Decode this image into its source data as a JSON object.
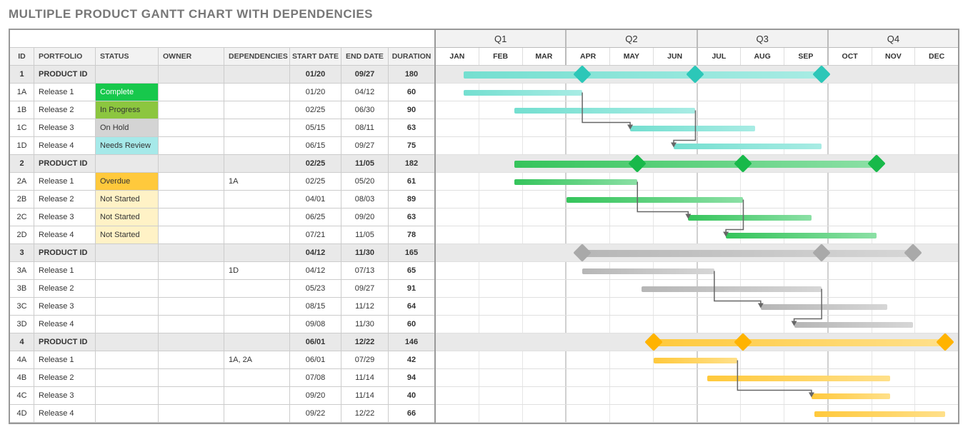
{
  "title": "MULTIPLE PRODUCT GANTT CHART WITH DEPENDENCIES",
  "headers": {
    "id": "ID",
    "portfolio": "PORTFOLIO",
    "status": "STATUS",
    "owner": "OWNER",
    "dependencies": "DEPENDENCIES",
    "start": "START DATE",
    "end": "END DATE",
    "duration": "DURATION"
  },
  "quarters": [
    "Q1",
    "Q2",
    "Q3",
    "Q4"
  ],
  "months": [
    "JAN",
    "FEB",
    "MAR",
    "APR",
    "MAY",
    "JUN",
    "JUL",
    "AUG",
    "SEP",
    "OCT",
    "NOV",
    "DEC"
  ],
  "status_labels": {
    "complete": "Complete",
    "inprogress": "In Progress",
    "onhold": "On Hold",
    "needsreview": "Needs Review",
    "overdue": "Overdue",
    "notstarted": "Not Started"
  },
  "colors": {
    "p1": {
      "barA": "#74dfd0",
      "barB": "#a8ece4",
      "diam": "#2cc7b8"
    },
    "p2": {
      "barA": "#35c45b",
      "barB": "#8be0a5",
      "diam": "#18b94a"
    },
    "p3": {
      "barA": "#b6b6b6",
      "barB": "#d6d6d6",
      "diam": "#a9a9a9"
    },
    "p4": {
      "barA": "#ffc93c",
      "barB": "#ffe08a",
      "diam": "#ffb300"
    }
  },
  "rows": [
    {
      "id": "1",
      "portfolio": "PRODUCT ID",
      "status": "",
      "owner": "",
      "dep": "",
      "start": "01/20",
      "end": "09/27",
      "dur": "180",
      "product": true,
      "group": "p1"
    },
    {
      "id": "1A",
      "portfolio": "Release 1",
      "statusKey": "complete",
      "owner": "",
      "dep": "",
      "start": "01/20",
      "end": "04/12",
      "dur": "60",
      "group": "p1"
    },
    {
      "id": "1B",
      "portfolio": "Release 2",
      "statusKey": "inprogress",
      "owner": "",
      "dep": "",
      "start": "02/25",
      "end": "06/30",
      "dur": "90",
      "group": "p1"
    },
    {
      "id": "1C",
      "portfolio": "Release 3",
      "statusKey": "onhold",
      "owner": "",
      "dep": "",
      "start": "05/15",
      "end": "08/11",
      "dur": "63",
      "group": "p1"
    },
    {
      "id": "1D",
      "portfolio": "Release 4",
      "statusKey": "needsreview",
      "owner": "",
      "dep": "",
      "start": "06/15",
      "end": "09/27",
      "dur": "75",
      "group": "p1"
    },
    {
      "id": "2",
      "portfolio": "PRODUCT ID",
      "status": "",
      "owner": "",
      "dep": "",
      "start": "02/25",
      "end": "11/05",
      "dur": "182",
      "product": true,
      "group": "p2"
    },
    {
      "id": "2A",
      "portfolio": "Release 1",
      "statusKey": "overdue",
      "owner": "",
      "dep": "1A",
      "start": "02/25",
      "end": "05/20",
      "dur": "61",
      "group": "p2"
    },
    {
      "id": "2B",
      "portfolio": "Release 2",
      "statusKey": "notstarted",
      "owner": "",
      "dep": "",
      "start": "04/01",
      "end": "08/03",
      "dur": "89",
      "group": "p2"
    },
    {
      "id": "2C",
      "portfolio": "Release 3",
      "statusKey": "notstarted",
      "owner": "",
      "dep": "",
      "start": "06/25",
      "end": "09/20",
      "dur": "63",
      "group": "p2"
    },
    {
      "id": "2D",
      "portfolio": "Release 4",
      "statusKey": "notstarted",
      "owner": "",
      "dep": "",
      "start": "07/21",
      "end": "11/05",
      "dur": "78",
      "group": "p2"
    },
    {
      "id": "3",
      "portfolio": "PRODUCT ID",
      "status": "",
      "owner": "",
      "dep": "",
      "start": "04/12",
      "end": "11/30",
      "dur": "165",
      "product": true,
      "group": "p3"
    },
    {
      "id": "3A",
      "portfolio": "Release 1",
      "statusKey": "",
      "owner": "",
      "dep": "1D",
      "start": "04/12",
      "end": "07/13",
      "dur": "65",
      "group": "p3"
    },
    {
      "id": "3B",
      "portfolio": "Release 2",
      "statusKey": "",
      "owner": "",
      "dep": "",
      "start": "05/23",
      "end": "09/27",
      "dur": "91",
      "group": "p3"
    },
    {
      "id": "3C",
      "portfolio": "Release 3",
      "statusKey": "",
      "owner": "",
      "dep": "",
      "start": "08/15",
      "end": "11/12",
      "dur": "64",
      "group": "p3"
    },
    {
      "id": "3D",
      "portfolio": "Release 4",
      "statusKey": "",
      "owner": "",
      "dep": "",
      "start": "09/08",
      "end": "11/30",
      "dur": "60",
      "group": "p3"
    },
    {
      "id": "4",
      "portfolio": "PRODUCT ID",
      "status": "",
      "owner": "",
      "dep": "",
      "start": "06/01",
      "end": "12/22",
      "dur": "146",
      "product": true,
      "group": "p4"
    },
    {
      "id": "4A",
      "portfolio": "Release 1",
      "statusKey": "",
      "owner": "",
      "dep": "1A, 2A",
      "start": "06/01",
      "end": "07/29",
      "dur": "42",
      "group": "p4"
    },
    {
      "id": "4B",
      "portfolio": "Release 2",
      "statusKey": "",
      "owner": "",
      "dep": "",
      "start": "07/08",
      "end": "11/14",
      "dur": "94",
      "group": "p4"
    },
    {
      "id": "4C",
      "portfolio": "Release 3",
      "statusKey": "",
      "owner": "",
      "dep": "",
      "start": "09/20",
      "end": "11/14",
      "dur": "40",
      "group": "p4"
    },
    {
      "id": "4D",
      "portfolio": "Release 4",
      "statusKey": "",
      "owner": "",
      "dep": "",
      "start": "09/22",
      "end": "12/22",
      "dur": "66",
      "group": "p4"
    }
  ],
  "milestones": {
    "1": [
      "04/12",
      "06/30",
      "09/27"
    ],
    "2": [
      "05/20",
      "08/03",
      "11/05"
    ],
    "3": [
      "04/12",
      "09/27",
      "11/30"
    ],
    "4": [
      "06/01",
      "08/03",
      "12/22"
    ]
  },
  "deps": [
    {
      "from": "1A",
      "to": "1C"
    },
    {
      "from": "1B",
      "to": "1D"
    },
    {
      "from": "2A",
      "to": "2C"
    },
    {
      "from": "2B",
      "to": "2D"
    },
    {
      "from": "3A",
      "to": "3C"
    },
    {
      "from": "3B",
      "to": "3D"
    },
    {
      "from": "4A",
      "to": "4C"
    }
  ],
  "chart_data": {
    "type": "gantt",
    "title": "MULTIPLE PRODUCT GANTT CHART WITH DEPENDENCIES",
    "time_axis": {
      "months": [
        "JAN",
        "FEB",
        "MAR",
        "APR",
        "MAY",
        "JUN",
        "JUL",
        "AUG",
        "SEP",
        "OCT",
        "NOV",
        "DEC"
      ],
      "quarters": [
        "Q1",
        "Q2",
        "Q3",
        "Q4"
      ]
    },
    "tasks": [
      {
        "id": "1",
        "name": "PRODUCT ID",
        "start": "01/20",
        "end": "09/27",
        "duration": 180,
        "milestones": [
          "04/12",
          "06/30",
          "09/27"
        ]
      },
      {
        "id": "1A",
        "name": "Release 1",
        "status": "Complete",
        "start": "01/20",
        "end": "04/12",
        "duration": 60
      },
      {
        "id": "1B",
        "name": "Release 2",
        "status": "In Progress",
        "start": "02/25",
        "end": "06/30",
        "duration": 90
      },
      {
        "id": "1C",
        "name": "Release 3",
        "status": "On Hold",
        "start": "05/15",
        "end": "08/11",
        "duration": 63,
        "depends_on": [
          "1A"
        ]
      },
      {
        "id": "1D",
        "name": "Release 4",
        "status": "Needs Review",
        "start": "06/15",
        "end": "09/27",
        "duration": 75,
        "depends_on": [
          "1B"
        ]
      },
      {
        "id": "2",
        "name": "PRODUCT ID",
        "start": "02/25",
        "end": "11/05",
        "duration": 182,
        "milestones": [
          "05/20",
          "08/03",
          "11/05"
        ]
      },
      {
        "id": "2A",
        "name": "Release 1",
        "status": "Overdue",
        "depends_on_ext": [
          "1A"
        ],
        "start": "02/25",
        "end": "05/20",
        "duration": 61
      },
      {
        "id": "2B",
        "name": "Release 2",
        "status": "Not Started",
        "start": "04/01",
        "end": "08/03",
        "duration": 89
      },
      {
        "id": "2C",
        "name": "Release 3",
        "status": "Not Started",
        "start": "06/25",
        "end": "09/20",
        "duration": 63,
        "depends_on": [
          "2A"
        ]
      },
      {
        "id": "2D",
        "name": "Release 4",
        "status": "Not Started",
        "start": "07/21",
        "end": "11/05",
        "duration": 78,
        "depends_on": [
          "2B"
        ]
      },
      {
        "id": "3",
        "name": "PRODUCT ID",
        "start": "04/12",
        "end": "11/30",
        "duration": 165,
        "milestones": [
          "04/12",
          "09/27",
          "11/30"
        ]
      },
      {
        "id": "3A",
        "name": "Release 1",
        "depends_on_ext": [
          "1D"
        ],
        "start": "04/12",
        "end": "07/13",
        "duration": 65
      },
      {
        "id": "3B",
        "name": "Release 2",
        "start": "05/23",
        "end": "09/27",
        "duration": 91
      },
      {
        "id": "3C",
        "name": "Release 3",
        "start": "08/15",
        "end": "11/12",
        "duration": 64,
        "depends_on": [
          "3A"
        ]
      },
      {
        "id": "3D",
        "name": "Release 4",
        "start": "09/08",
        "end": "11/30",
        "duration": 60,
        "depends_on": [
          "3B"
        ]
      },
      {
        "id": "4",
        "name": "PRODUCT ID",
        "start": "06/01",
        "end": "12/22",
        "duration": 146,
        "milestones": [
          "06/01",
          "08/03",
          "12/22"
        ]
      },
      {
        "id": "4A",
        "name": "Release 1",
        "depends_on_ext": [
          "1A",
          "2A"
        ],
        "start": "06/01",
        "end": "07/29",
        "duration": 42
      },
      {
        "id": "4B",
        "name": "Release 2",
        "start": "07/08",
        "end": "11/14",
        "duration": 94
      },
      {
        "id": "4C",
        "name": "Release 3",
        "start": "09/20",
        "end": "11/14",
        "duration": 40,
        "depends_on": [
          "4A"
        ]
      },
      {
        "id": "4D",
        "name": "Release 4",
        "start": "09/22",
        "end": "12/22",
        "duration": 66
      }
    ]
  }
}
